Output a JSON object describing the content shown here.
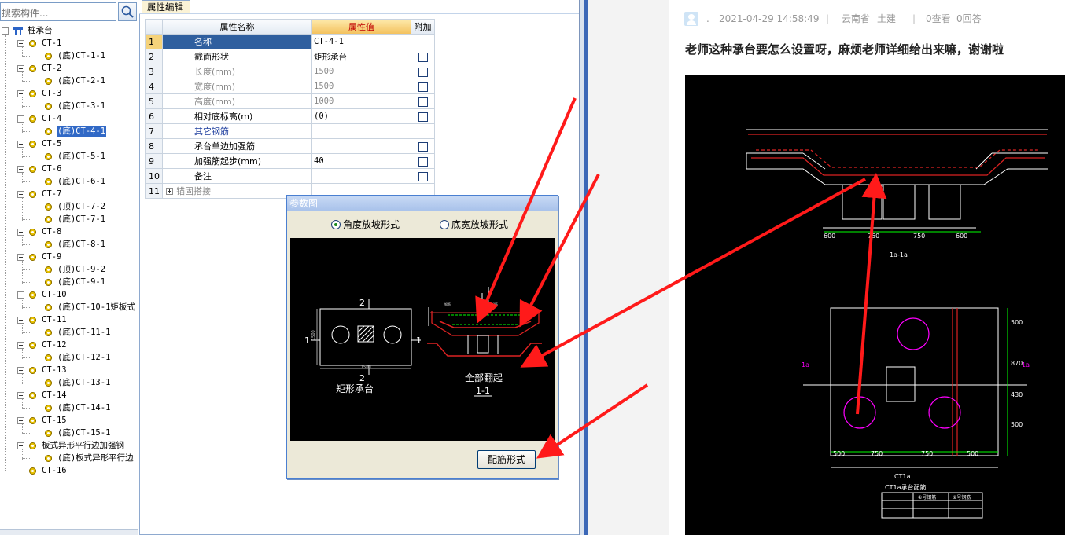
{
  "search": {
    "placeholder": "搜索构件..."
  },
  "tree": {
    "root": "桩承台",
    "nodes": [
      {
        "label": "CT-1",
        "child": "(底)CT-1-1"
      },
      {
        "label": "CT-2",
        "child": "(底)CT-2-1"
      },
      {
        "label": "CT-3",
        "child": "(底)CT-3-1"
      },
      {
        "label": "CT-4",
        "child": "(底)CT-4-1"
      },
      {
        "label": "CT-5",
        "child": "(底)CT-5-1"
      },
      {
        "label": "CT-6",
        "child": "(底)CT-6-1"
      },
      {
        "label": "CT-7",
        "children": [
          "(顶)CT-7-2",
          "(底)CT-7-1"
        ]
      },
      {
        "label": "CT-8",
        "child": "(底)CT-8-1"
      },
      {
        "label": "CT-9",
        "children": [
          "(顶)CT-9-2",
          "(底)CT-9-1"
        ]
      },
      {
        "label": "CT-10",
        "child": "(底)CT-10-1矩板式"
      },
      {
        "label": "CT-11",
        "child": "(底)CT-11-1"
      },
      {
        "label": "CT-12",
        "child": "(底)CT-12-1"
      },
      {
        "label": "CT-13",
        "child": "(底)CT-13-1"
      },
      {
        "label": "CT-14",
        "child": "(底)CT-14-1"
      },
      {
        "label": "CT-15",
        "child": "(底)CT-15-1"
      },
      {
        "label": "板式异形平行边加强钢",
        "child": "(底)板式异形平行边"
      },
      {
        "label": "CT-16"
      }
    ],
    "selected": "(底)CT-4-1"
  },
  "property_editor": {
    "tab": "属性编辑",
    "headers": {
      "name": "属性名称",
      "value": "属性值",
      "extra": "附加"
    },
    "rows": [
      {
        "num": "1",
        "name": "名称",
        "value": "CT-4-1",
        "checkbox": false,
        "style": "selected"
      },
      {
        "num": "2",
        "name": "截面形状",
        "value": "矩形承台",
        "checkbox": true,
        "style": "normal"
      },
      {
        "num": "3",
        "name": "长度(mm)",
        "value": "1500",
        "checkbox": true,
        "style": "gray"
      },
      {
        "num": "4",
        "name": "宽度(mm)",
        "value": "1500",
        "checkbox": true,
        "style": "gray"
      },
      {
        "num": "5",
        "name": "高度(mm)",
        "value": "1000",
        "checkbox": true,
        "style": "gray"
      },
      {
        "num": "6",
        "name": "相对底标高(m)",
        "value": "(0)",
        "checkbox": true,
        "style": "normal"
      },
      {
        "num": "7",
        "name": "其它钢筋",
        "value": "",
        "checkbox": false,
        "style": "blue"
      },
      {
        "num": "8",
        "name": "承台单边加强筋",
        "value": "",
        "checkbox": true,
        "style": "normal"
      },
      {
        "num": "9",
        "name": "加强筋起步(mm)",
        "value": "40",
        "checkbox": true,
        "style": "normal"
      },
      {
        "num": "10",
        "name": "备注",
        "value": "",
        "checkbox": true,
        "style": "normal"
      },
      {
        "num": "11",
        "name": "锚固搭接",
        "value": "",
        "checkbox": false,
        "style": "gray",
        "expandable": true
      }
    ]
  },
  "param_dialog": {
    "title": "参数图",
    "options": [
      {
        "label": "角度放坡形式",
        "selected": true
      },
      {
        "label": "底宽放坡形式",
        "selected": false
      }
    ],
    "drawing": {
      "plan_label": "矩形承台",
      "section_label": "全部翻起",
      "section_id": "1-1",
      "marker_1": "1",
      "marker_2": "2",
      "dim_plan_width": "1500",
      "dim_plan_height": "1500"
    },
    "button": "配筋形式"
  },
  "article": {
    "meta": {
      "separator": ".",
      "datetime": "2021-04-29 14:58:49",
      "location": "云南省",
      "category": "土建",
      "views": "0查看",
      "answers": "0回答"
    },
    "question": "老师这种承台要怎么设置呀，麻烦老师详细给出来嘛，谢谢啦",
    "cad": {
      "dims_bottom": [
        "600",
        "750",
        "750",
        "600"
      ],
      "section_label": "1a-1a",
      "plan_dims_bottom": [
        "500",
        "750",
        "750",
        "500"
      ],
      "plan_dims_right": [
        "500",
        "870",
        "430",
        "500"
      ],
      "plan_marker": "1a",
      "plan_title": "CT1a",
      "table_title": "CT1a承台配筋",
      "rebar_1": "①号钢筋",
      "rebar_2": "②号钢筋"
    }
  },
  "colors": {
    "arrow": "#ff1a1a",
    "selection": "#3169c6",
    "cad_bg": "#000000"
  }
}
